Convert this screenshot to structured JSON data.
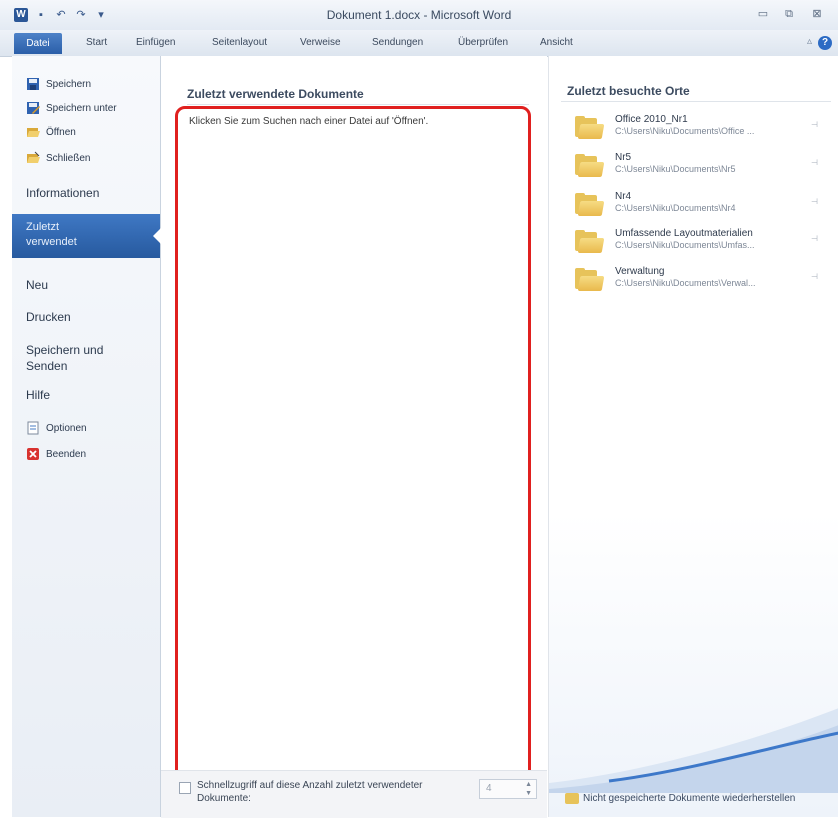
{
  "window": {
    "title": "Dokument 1.docx - Microsoft Word",
    "app_icon_letter": "W",
    "controls": {
      "minimize": "▭",
      "maximize": "⧉",
      "close": "⊠"
    }
  },
  "ribbon": {
    "tabs": [
      "Datei",
      "Start",
      "Einfügen",
      "Seitenlayout",
      "Verweise",
      "Sendungen",
      "Überprüfen",
      "Ansicht"
    ],
    "help": "?"
  },
  "nav": {
    "commands": [
      {
        "label": "Speichern",
        "icon": "save-icon"
      },
      {
        "label": "Speichern unter",
        "icon": "save-as-icon"
      },
      {
        "label": "Öffnen",
        "icon": "open-folder-icon"
      },
      {
        "label": "Schließen",
        "icon": "close-document-icon"
      }
    ],
    "items": [
      "Informationen",
      "Zuletzt verwendet",
      "Neu",
      "Drucken",
      "Speichern und Senden",
      "Hilfe"
    ],
    "active_item_line1": "Zuletzt",
    "active_item_line2": "verwendet",
    "save_send_line1": "Speichern und",
    "save_send_line2": "Senden",
    "bottom_commands": [
      {
        "label": "Optionen",
        "icon": "options-icon"
      },
      {
        "label": "Beenden",
        "icon": "exit-icon"
      }
    ]
  },
  "recent_documents": {
    "title": "Zuletzt verwendete Dokumente",
    "empty_hint": "Klicken Sie zum Suchen nach einer Datei auf 'Öffnen'.",
    "quick_access_label": "Schnellzugriff auf diese Anzahl zuletzt verwendeter Dokumente:",
    "quick_access_value": "4"
  },
  "recent_places": {
    "title": "Zuletzt besuchte Orte",
    "items": [
      {
        "name": "Office 2010_Nr1",
        "path": "C:\\Users\\Niku\\Documents\\Office ..."
      },
      {
        "name": "Nr5",
        "path": "C:\\Users\\Niku\\Documents\\Nr5"
      },
      {
        "name": "Nr4",
        "path": "C:\\Users\\Niku\\Documents\\Nr4"
      },
      {
        "name": "Umfassende Layoutmaterialien",
        "path": "C:\\Users\\Niku\\Documents\\Umfas..."
      },
      {
        "name": "Verwaltung",
        "path": "C:\\Users\\Niku\\Documents\\Verwal..."
      }
    ],
    "restore_label": "Nicht gespeicherte Dokumente wiederherstellen"
  }
}
